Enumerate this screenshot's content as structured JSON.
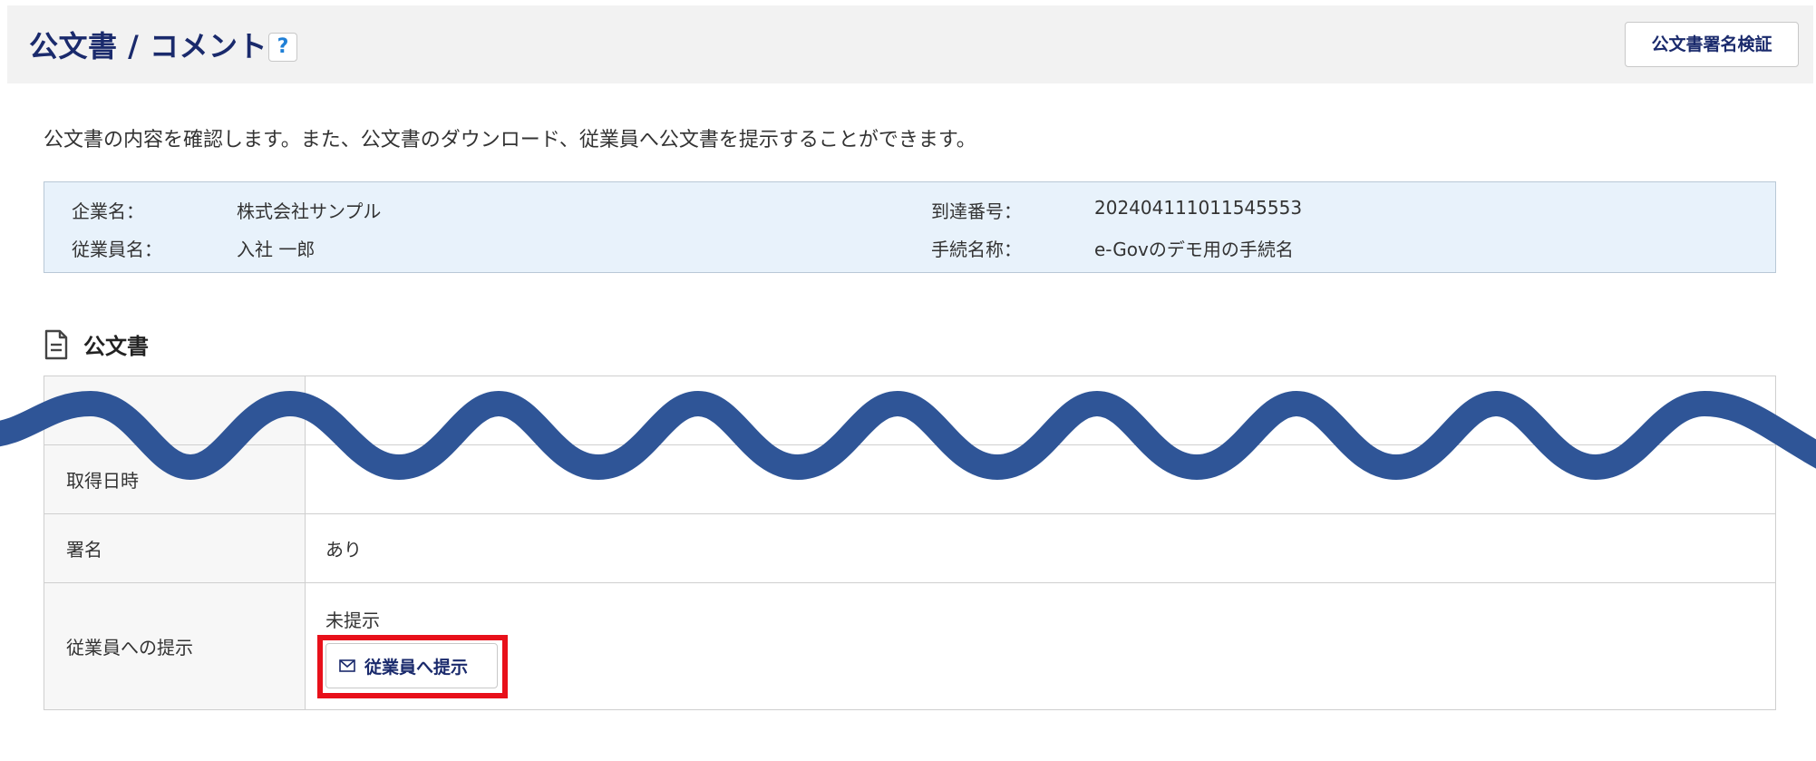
{
  "header": {
    "title": "公文書 / コメント",
    "help_label": "?",
    "verify_button": "公文書署名検証"
  },
  "description": "公文書の内容を確認します。また、公文書のダウンロード、従業員へ公文書を提示することができます。",
  "info": {
    "company_label": "企業名：",
    "company_value": "株式会社サンプル",
    "employee_label": "従業員名：",
    "employee_value": "入社 一郎",
    "arrival_label": "到達番号：",
    "arrival_value": "202404111011545553",
    "procedure_label": "手続名称：",
    "procedure_value": "e-Govのデモ用の手続名"
  },
  "section": {
    "title": "公文書",
    "icon": "document-icon"
  },
  "table": {
    "rows": [
      {
        "label": "",
        "value": ""
      },
      {
        "label": "取得日時",
        "value": ""
      },
      {
        "label": "署名",
        "value": "あり"
      },
      {
        "label": "従業員への提示",
        "value": "未提示"
      }
    ],
    "present_button": "従業員へ提示",
    "present_icon": "mail-icon"
  },
  "colors": {
    "title": "#1a2a6c",
    "info_bg": "#e8f2fb",
    "highlight": "#e8101a",
    "wave": "#2f5597"
  }
}
